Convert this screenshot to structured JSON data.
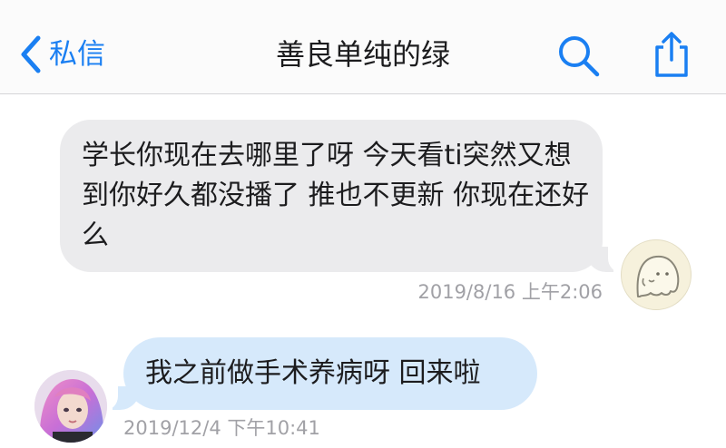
{
  "nav": {
    "back_label": "私信",
    "title": "善良单纯的绿",
    "accent_color": "#1a7ff2",
    "back_icon": "chevron-left-icon",
    "search_icon": "search-icon",
    "share_icon": "share-icon"
  },
  "messages": [
    {
      "direction": "incoming",
      "text": "学长你现在去哪里了呀 今天看ti突然又想到你好久都没播了 推也不更新 你现在还好么",
      "timestamp": "2019/8/16 上午2:06",
      "avatar": "ghost-doodle-avatar",
      "bubble_color": "#ebebed"
    },
    {
      "direction": "outgoing",
      "text": "我之前做手术养病呀 回来啦",
      "timestamp": "2019/12/4 下午10:41",
      "avatar": "user-photo-avatar",
      "bubble_color": "#d6e9fb"
    }
  ]
}
